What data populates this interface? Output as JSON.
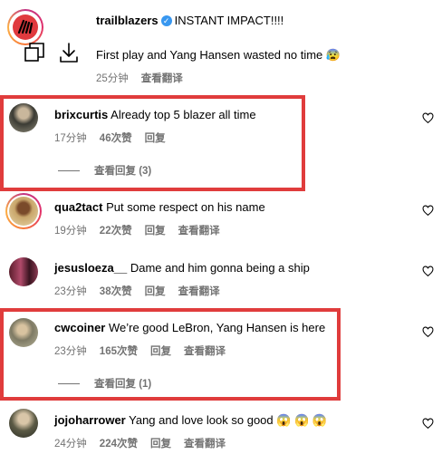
{
  "post": {
    "username": "trailblazers",
    "caption": "INSTANT IMPACT!!!!",
    "subcaption": "First play and Yang Hansen wasted no time 😰",
    "time": "25分钟",
    "translate": "查看翻译"
  },
  "labels": {
    "reply": "回复",
    "translate": "查看翻译"
  },
  "comments": [
    {
      "username": "brixcurtis",
      "text": "Already top 5 blazer all time",
      "time": "17分钟",
      "likes": "46次赞",
      "view_replies": "查看回复 (3)"
    },
    {
      "username": "qua2tact",
      "text": "Put some respect on his name",
      "time": "19分钟",
      "likes": "22次赞"
    },
    {
      "username": "jesusloeza__",
      "text": "Dame and him gonna being a ship",
      "time": "23分钟",
      "likes": "38次赞"
    },
    {
      "username": "cwcoiner",
      "text": "We’re good LeBron, Yang Hansen is here",
      "time": "23分钟",
      "likes": "165次赞",
      "view_replies": "查看回复 (1)"
    },
    {
      "username": "jojoharrower",
      "text": "Yang and love look so good 😱 😱 😱",
      "time": "24分钟",
      "likes": "224次赞"
    }
  ],
  "colors": {
    "highlight": "#e03c3c",
    "meta": "#737373",
    "verified": "#3897f0"
  }
}
